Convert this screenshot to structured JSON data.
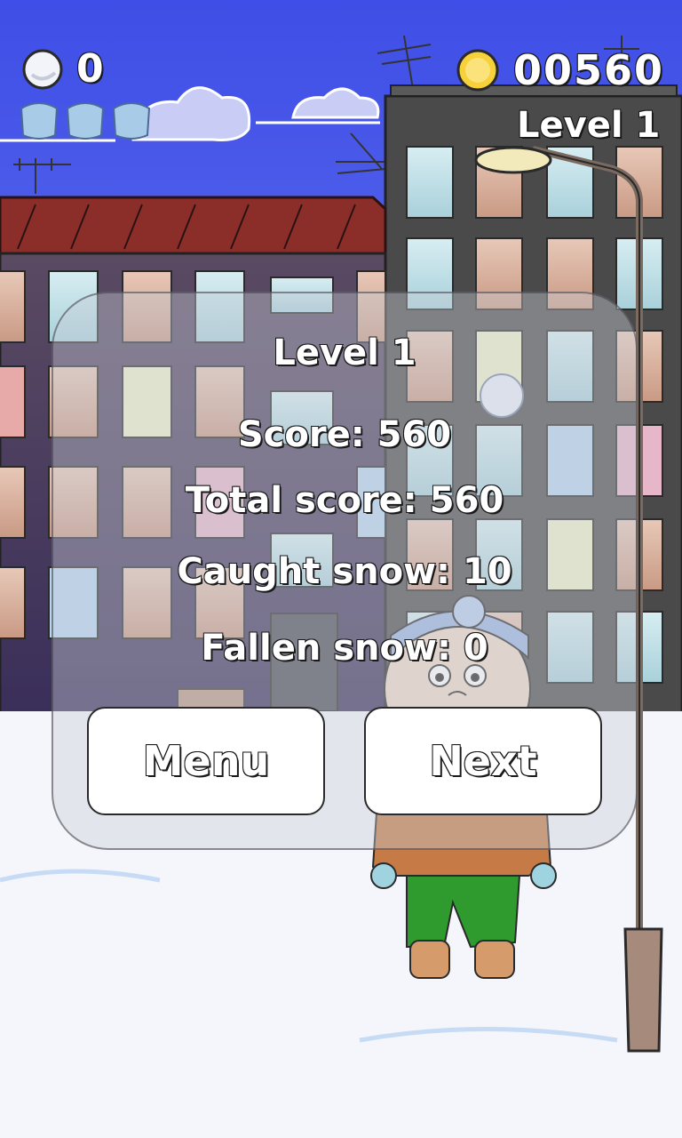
{
  "hud": {
    "snowball_count": "0",
    "coin_score": "00560",
    "level_label": "Level 1",
    "lives": [
      "life-1",
      "life-2",
      "life-3"
    ]
  },
  "result_panel": {
    "title": "Level 1",
    "score": "Score: 560",
    "total_score": "Total score: 560",
    "caught_snow": "Caught snow: 10",
    "fallen_snow": "Fallen snow: 0"
  },
  "buttons": {
    "menu_label": "Menu",
    "next_label": "Next"
  },
  "colors": {
    "sky": "#4a5fe8",
    "snow": "#f4f6fb",
    "coin": "#f7d13a",
    "roof": "#8b2e2a"
  }
}
